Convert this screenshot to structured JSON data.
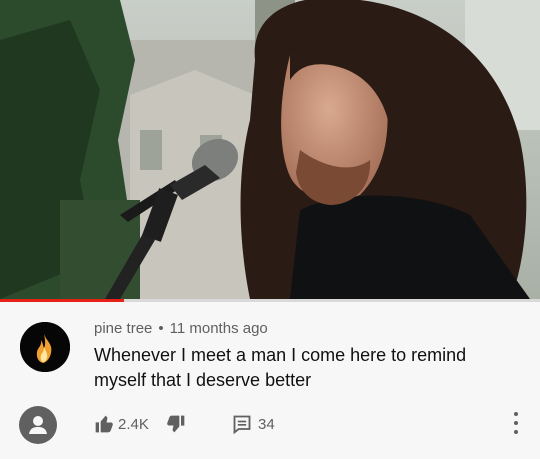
{
  "video": {
    "progress": 0.23
  },
  "comment": {
    "author": "pine tree",
    "separator": "•",
    "time": "11 months ago",
    "text": "Whenever I meet a man I come here to remind myself that I deserve better",
    "likes": "2.4K",
    "replies": "34"
  },
  "icons": {
    "author_avatar": "flame-avatar-icon",
    "user_avatar": "person-icon",
    "like": "thumbs-up-icon",
    "dislike": "thumbs-down-icon",
    "reply": "comment-icon",
    "menu": "more-vertical-icon"
  },
  "colors": {
    "progress": "#e62117",
    "meta_text": "#606060",
    "body_text": "#111111"
  }
}
